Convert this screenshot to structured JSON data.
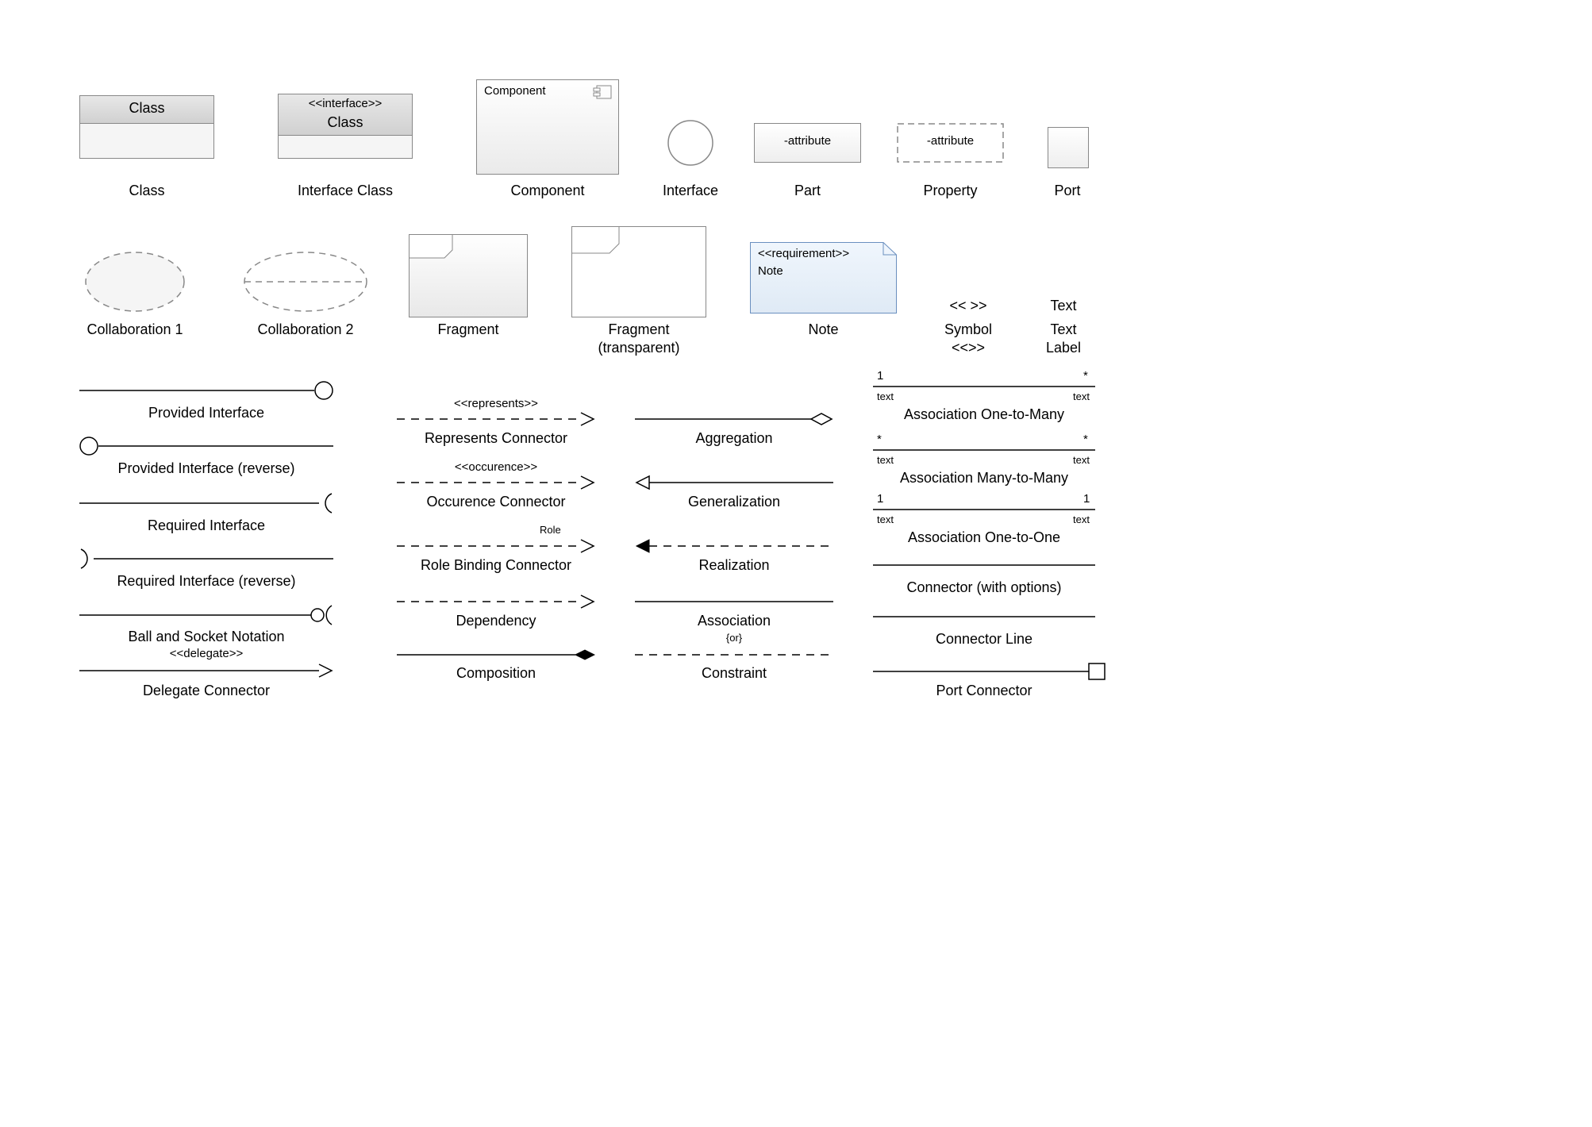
{
  "row1": {
    "class": {
      "title": "Class",
      "label": "Class"
    },
    "interfaceClass": {
      "stereotype": "<<interface>>",
      "title": "Class",
      "label": "Interface Class"
    },
    "component": {
      "title": "Component",
      "label": "Component"
    },
    "interface": {
      "label": "Interface"
    },
    "part": {
      "text": "-attribute",
      "label": "Part"
    },
    "property": {
      "text": "-attribute",
      "label": "Property"
    },
    "port": {
      "label": "Port"
    }
  },
  "row2": {
    "collab1": {
      "label": "Collaboration 1"
    },
    "collab2": {
      "label": "Collaboration 2"
    },
    "fragment": {
      "label": "Fragment"
    },
    "fragmentTransparent": {
      "label1": "Fragment",
      "label2": "(transparent)"
    },
    "note": {
      "stereotype": "<<requirement>>",
      "text": "Note",
      "label": "Note"
    },
    "symbol": {
      "text": "<< >>",
      "label1": "Symbol",
      "label2": "<<>>"
    },
    "textLabel": {
      "text": "Text",
      "label1": "Text",
      "label2": "Label"
    }
  },
  "col1": {
    "providedInterface": "Provided Interface",
    "providedInterfaceReverse": "Provided Interface (reverse)",
    "requiredInterface": "Required Interface",
    "requiredInterfaceReverse": "Required Interface (reverse)",
    "ballSocket": "Ball and Socket Notation",
    "delegate": {
      "stereotype": "<<delegate>>",
      "label": "Delegate Connector"
    }
  },
  "col2": {
    "represents": {
      "stereotype": "<<represents>>",
      "label": "Represents Connector"
    },
    "occurence": {
      "stereotype": "<<occurence>>",
      "label": "Occurence Connector"
    },
    "roleBinding": {
      "role": "Role",
      "label": "Role Binding Connector"
    },
    "dependency": "Dependency",
    "composition": "Composition"
  },
  "col3": {
    "aggregation": "Aggregation",
    "generalization": "Generalization",
    "realization": "Realization",
    "association": "Association",
    "constraint": {
      "text": "{or}",
      "label": "Constraint"
    }
  },
  "col4": {
    "assoc1toMany": {
      "left": "1",
      "right": "*",
      "leftText": "text",
      "rightText": "text",
      "label": "Association One-to-Many"
    },
    "assocManyToMany": {
      "left": "*",
      "right": "*",
      "leftText": "text",
      "rightText": "text",
      "label": "Association Many-to-Many"
    },
    "assoc1to1": {
      "left": "1",
      "right": "1",
      "leftText": "text",
      "rightText": "text",
      "label": "Association One-to-One"
    },
    "connectorOptions": "Connector (with options)",
    "connectorLine": "Connector Line",
    "portConnector": "Port Connector"
  }
}
